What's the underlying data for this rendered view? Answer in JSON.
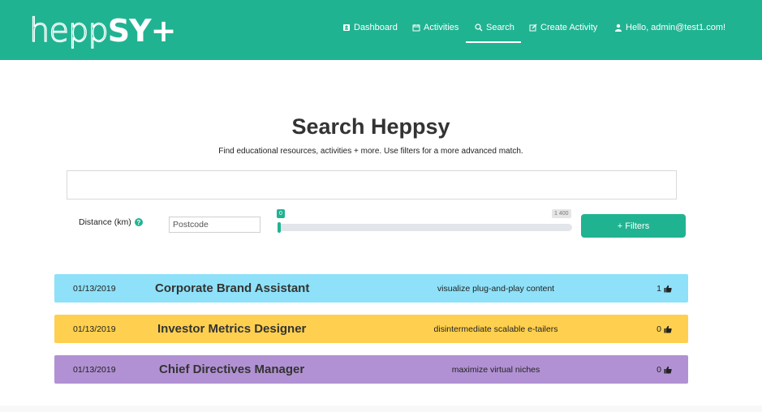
{
  "navbar": {
    "logo_part1": "heppSY",
    "logo_part2": "+",
    "items": [
      {
        "label": "Dashboard",
        "icon": "user-badge-icon"
      },
      {
        "label": "Activities",
        "icon": "calendar-icon"
      },
      {
        "label": "Search",
        "icon": "search-icon",
        "active": true
      },
      {
        "label": "Create Activity",
        "icon": "edit-icon"
      },
      {
        "label": "Hello, admin@test1.com!",
        "icon": "user-icon"
      }
    ]
  },
  "page": {
    "title": "Search Heppsy",
    "subtitle": "Find educational resources, activities + more. Use filters for a more advanced match."
  },
  "search": {
    "value": "",
    "placeholder": ""
  },
  "filters": {
    "distance_label": "Distance (km)",
    "postcode_placeholder": "Postcode",
    "slider_min": "0",
    "slider_max": "1 400",
    "slider_value": 0,
    "filters_button": "+ Filters"
  },
  "colors": {
    "brand": "#20b392",
    "row_blue": "#8ee1f8",
    "row_yellow": "#ffd04f",
    "row_purple": "#b191d3"
  },
  "results": [
    {
      "date": "01/13/2019",
      "name": "Corporate Brand Assistant",
      "description": "visualize plug-and-play content",
      "likes": "1",
      "color": "#8ee1f8"
    },
    {
      "date": "01/13/2019",
      "name": "Investor Metrics Designer",
      "description": "disintermediate scalable e-tailers",
      "likes": "0",
      "color": "#ffd04f"
    },
    {
      "date": "01/13/2019",
      "name": "Chief Directives Manager",
      "description": "maximize virtual niches",
      "likes": "0",
      "color": "#b191d3"
    }
  ]
}
